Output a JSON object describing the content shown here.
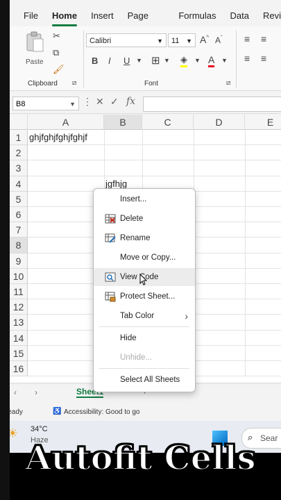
{
  "ribbon": {
    "tabs": [
      "File",
      "Home",
      "Insert",
      "Page Layout",
      "Formulas",
      "Data",
      "Revi"
    ],
    "active_tab": "Home",
    "paste_label": "Paste",
    "clipboard_label": "Clipboard",
    "font_group_label": "Font",
    "font_name": "Calibri",
    "font_size": "11"
  },
  "formula_bar": {
    "name_box": "B8",
    "fx": "fx"
  },
  "grid": {
    "columns": [
      "A",
      "B",
      "C",
      "D",
      "E"
    ],
    "rows": [
      "1",
      "2",
      "3",
      "4",
      "5",
      "6",
      "7",
      "8",
      "9",
      "10",
      "11",
      "12",
      "13",
      "14",
      "15",
      "16"
    ],
    "cells": {
      "A1": "ghjfghjfghjfghjf",
      "B4": "jgfhjg"
    }
  },
  "context_menu": {
    "insert": "Insert...",
    "delete": "Delete",
    "rename": "Rename",
    "move_copy": "Move or Copy...",
    "view_code": "View Code",
    "protect_sheet": "Protect Sheet...",
    "tab_color": "Tab Color",
    "hide": "Hide",
    "unhide": "Unhide...",
    "select_all": "Select All Sheets"
  },
  "sheet_tabs": {
    "active": "Sheet1"
  },
  "status": {
    "ready": "Ready",
    "accessibility": "Accessibility: Good to go"
  },
  "taskbar": {
    "temperature": "34°C",
    "weather": "Haze",
    "search": "Sear"
  },
  "caption": "Autofit Cells",
  "colors": {
    "accent": "#107c41",
    "font_color_bar": "#e81123",
    "highlight_bar": "#ffff00"
  }
}
